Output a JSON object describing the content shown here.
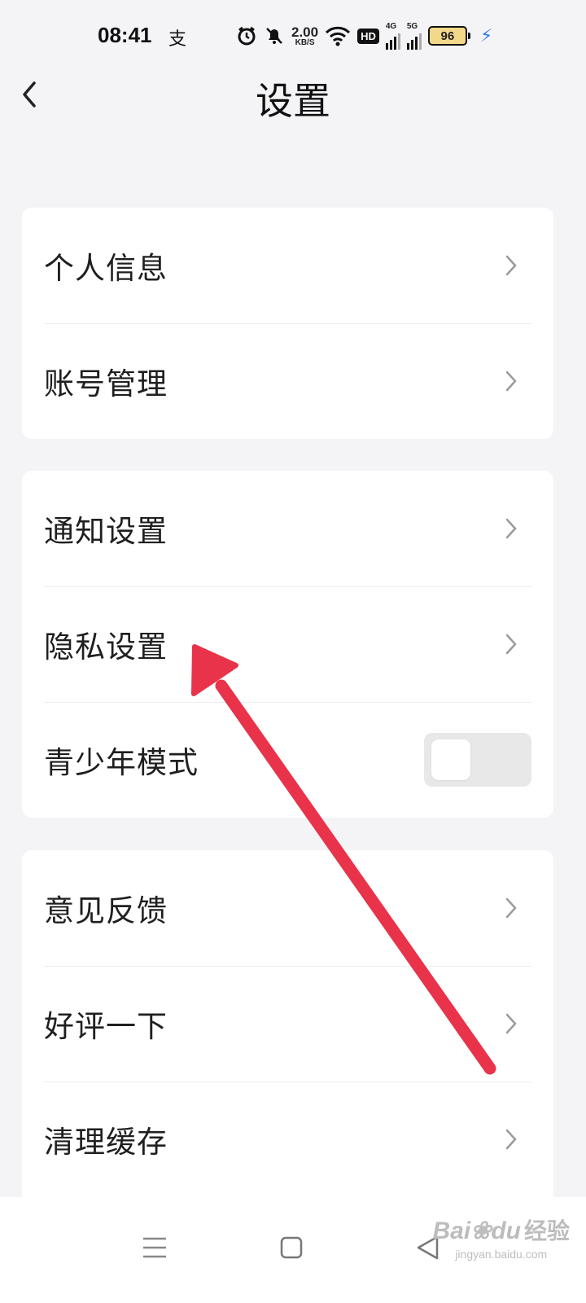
{
  "status_bar": {
    "time": "08:41",
    "app_icon_glyph": "支",
    "net_speed_value": "2.00",
    "net_speed_unit": "KB/S",
    "hd_label": "HD",
    "signal_1_label": "4G",
    "signal_2_label": "5G",
    "battery_level": "96",
    "icons": [
      "alarm-icon",
      "mute-icon",
      "wifi-icon",
      "hd-icon",
      "signal-4g-icon",
      "signal-5g-icon",
      "battery-icon",
      "charging-icon"
    ]
  },
  "header": {
    "title": "设置",
    "back_icon": "chevron-left-icon"
  },
  "groups": [
    {
      "items": [
        {
          "label": "个人信息",
          "type": "link"
        },
        {
          "label": "账号管理",
          "type": "link"
        }
      ]
    },
    {
      "items": [
        {
          "label": "通知设置",
          "type": "link"
        },
        {
          "label": "隐私设置",
          "type": "link"
        },
        {
          "label": "青少年模式",
          "type": "toggle",
          "toggle_state": "off"
        }
      ]
    },
    {
      "items": [
        {
          "label": "意见反馈",
          "type": "link"
        },
        {
          "label": "好评一下",
          "type": "link"
        },
        {
          "label": "清理缓存",
          "type": "link"
        }
      ]
    }
  ],
  "nav_bar": {
    "icons": [
      "menu-icon",
      "home-icon",
      "back-triangle-icon"
    ]
  },
  "annotation": {
    "color": "#e8334a",
    "points_to": "隐私设置"
  },
  "watermark": {
    "logo_text": "Bai",
    "logo_text2": "du",
    "logo_zh": "经验",
    "url": "jingyan.baidu.com"
  },
  "colors": {
    "background": "#f4f4f7",
    "card": "#ffffff",
    "accent_arrow": "#e8334a",
    "charging": "#3c7cf0"
  }
}
